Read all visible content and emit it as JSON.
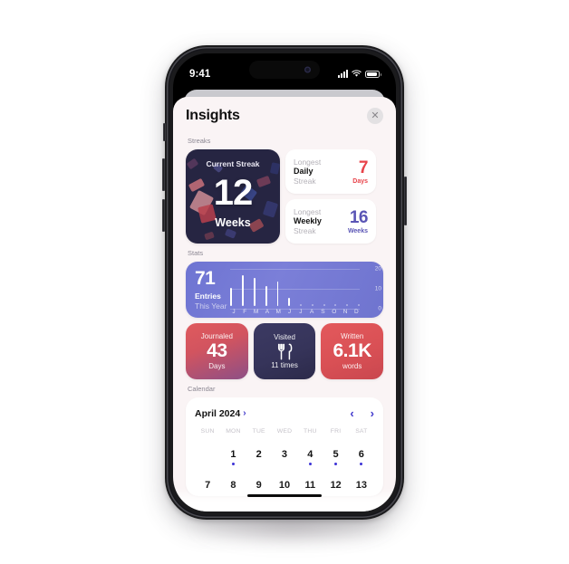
{
  "status_bar": {
    "time": "9:41",
    "signal_icon": "cellular-signal-icon",
    "wifi_icon": "wifi-icon",
    "battery_icon": "battery-icon"
  },
  "sheet": {
    "title": "Insights",
    "close_label": "✕"
  },
  "sections": {
    "streaks_label": "Streaks",
    "stats_label": "Stats",
    "calendar_label": "Calendar"
  },
  "current_streak": {
    "label": "Current Streak",
    "value": "12",
    "unit": "Weeks"
  },
  "longest_daily": {
    "line1": "Longest",
    "line2": "Daily",
    "line3": "Streak",
    "value": "7",
    "unit": "Days",
    "color": "#e8434a"
  },
  "longest_weekly": {
    "line1": "Longest",
    "line2": "Weekly",
    "line3": "Streak",
    "value": "16",
    "unit": "Weeks",
    "color": "#5a55b5"
  },
  "entries": {
    "value": "71",
    "line1": "Entries",
    "line2": "This Year"
  },
  "stat_cards": [
    {
      "top": "Journaled",
      "big": "43",
      "bottom": "Days",
      "style": "red-purple",
      "icon": ""
    },
    {
      "top": "Visited",
      "big": "",
      "bottom": "11 times",
      "style": "navy",
      "icon": "fork-knife-icon"
    },
    {
      "top": "Written",
      "big": "6.1K",
      "bottom": "words",
      "style": "red",
      "icon": ""
    }
  ],
  "calendar": {
    "month": "April 2024",
    "caret": "›",
    "prev": "‹",
    "next": "›",
    "dow": [
      "SUN",
      "MON",
      "TUE",
      "WED",
      "THU",
      "FRI",
      "SAT"
    ],
    "week1": [
      {
        "day": "",
        "dot": false
      },
      {
        "day": "1",
        "dot": true
      },
      {
        "day": "2",
        "dot": false
      },
      {
        "day": "3",
        "dot": false
      },
      {
        "day": "4",
        "dot": true
      },
      {
        "day": "5",
        "dot": true
      },
      {
        "day": "6",
        "dot": true
      }
    ],
    "week2": [
      "7",
      "8",
      "9",
      "10",
      "11",
      "12",
      "13"
    ]
  },
  "chart_data": {
    "type": "bar",
    "title": "Entries This Year",
    "categories": [
      "J",
      "F",
      "M",
      "A",
      "M",
      "J",
      "J",
      "A",
      "S",
      "O",
      "N",
      "D"
    ],
    "values": [
      11,
      19,
      17,
      12,
      15,
      5,
      0,
      0,
      0,
      0,
      0,
      0
    ],
    "ylim": [
      0,
      20
    ],
    "yticks": [
      20,
      10,
      0
    ],
    "ytick_labels": [
      "20",
      "10",
      "0"
    ],
    "xlabel": "",
    "ylabel": "",
    "grid": true,
    "legend": false,
    "bar_color": "#ffffff"
  },
  "confetti_pieces": [
    {
      "l": 4,
      "t": 34,
      "w": 16,
      "h": 9,
      "r": -28,
      "c": "#c9717a"
    },
    {
      "l": 8,
      "t": 46,
      "w": 19,
      "h": 22,
      "r": 28,
      "c": "#cf8d94"
    },
    {
      "l": 14,
      "t": 60,
      "w": 17,
      "h": 18,
      "r": -14,
      "c": "#b8404c"
    },
    {
      "l": 60,
      "t": 40,
      "w": 15,
      "h": 12,
      "r": 36,
      "c": "#3c4a8f"
    },
    {
      "l": 76,
      "t": 30,
      "w": 14,
      "h": 9,
      "r": -20,
      "c": "#7a3f59"
    },
    {
      "l": 84,
      "t": 56,
      "w": 13,
      "h": 16,
      "r": 18,
      "c": "#363a72"
    },
    {
      "l": 30,
      "t": 16,
      "w": 9,
      "h": 7,
      "r": 40,
      "c": "#4a4a82"
    },
    {
      "l": 2,
      "t": 12,
      "w": 11,
      "h": 8,
      "r": -35,
      "c": "#5a3a5e"
    },
    {
      "l": 68,
      "t": 76,
      "w": 14,
      "h": 10,
      "r": -30,
      "c": "#9c4a52"
    },
    {
      "l": 42,
      "t": 86,
      "w": 11,
      "h": 8,
      "r": 22,
      "c": "#3e3e78"
    },
    {
      "l": 20,
      "t": 88,
      "w": 10,
      "h": 7,
      "r": -18,
      "c": "#6b3a4e"
    },
    {
      "l": 90,
      "t": 14,
      "w": 9,
      "h": 12,
      "r": 12,
      "c": "#2f3468"
    }
  ]
}
